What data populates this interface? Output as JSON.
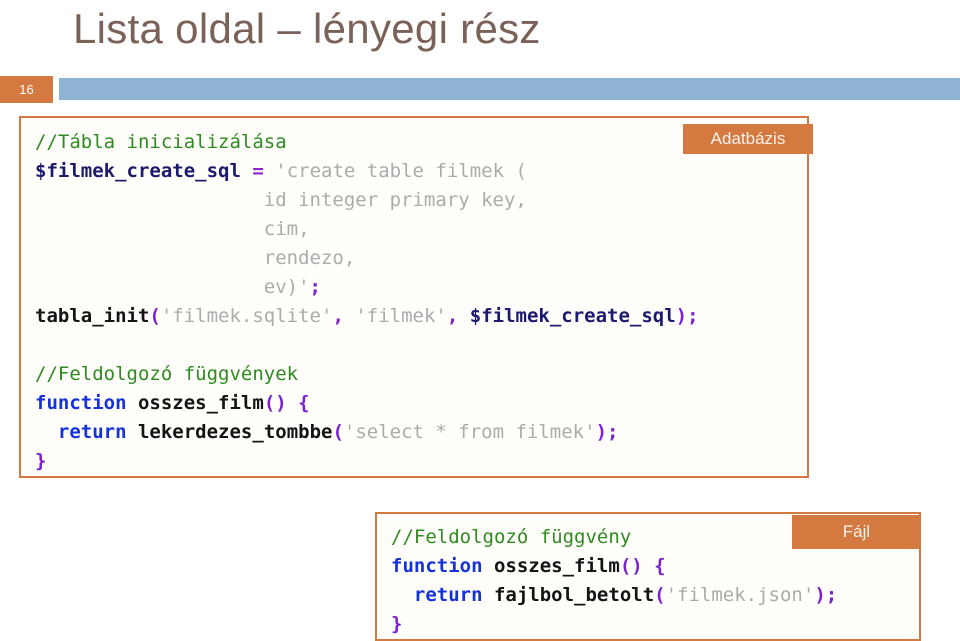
{
  "slide": {
    "title": "Lista oldal – lényegi rész",
    "number": "16",
    "title_color": "#7A6258",
    "accent_color": "#D4793F",
    "rule_color": "#8FB3D2"
  },
  "database_block": {
    "tag": "Adatbázis",
    "lines": [
      [
        {
          "text": "//Tábla inicializálása",
          "type": "comment"
        }
      ],
      [
        {
          "text": "$filmek_create_sql",
          "type": "var"
        },
        {
          "text": " ",
          "type": "plain"
        },
        {
          "text": "=",
          "type": "op"
        },
        {
          "text": " ",
          "type": "plain"
        },
        {
          "text": "'create table filmek (",
          "type": "string"
        }
      ],
      [
        {
          "text": "                    id integer primary key,",
          "type": "string"
        }
      ],
      [
        {
          "text": "                    cim,",
          "type": "string"
        }
      ],
      [
        {
          "text": "                    rendezo,",
          "type": "string"
        }
      ],
      [
        {
          "text": "                    ev)'",
          "type": "string"
        },
        {
          "text": ";",
          "type": "punct"
        }
      ],
      [
        {
          "text": "tabla_init",
          "type": "fn"
        },
        {
          "text": "(",
          "type": "punct"
        },
        {
          "text": "'filmek.sqlite'",
          "type": "string"
        },
        {
          "text": ",",
          "type": "punct"
        },
        {
          "text": " ",
          "type": "plain"
        },
        {
          "text": "'filmek'",
          "type": "string"
        },
        {
          "text": ",",
          "type": "punct"
        },
        {
          "text": " ",
          "type": "plain"
        },
        {
          "text": "$filmek_create_sql",
          "type": "var"
        },
        {
          "text": ");",
          "type": "punct"
        }
      ],
      [
        {
          "text": "",
          "type": "plain"
        }
      ],
      [
        {
          "text": "//Feldolgozó függvények",
          "type": "comment"
        }
      ],
      [
        {
          "text": "function",
          "type": "kw"
        },
        {
          "text": " ",
          "type": "plain"
        },
        {
          "text": "osszes_film",
          "type": "fn"
        },
        {
          "text": "() {",
          "type": "punct"
        }
      ],
      [
        {
          "text": "  ",
          "type": "plain"
        },
        {
          "text": "return",
          "type": "kw"
        },
        {
          "text": " ",
          "type": "plain"
        },
        {
          "text": "lekerdezes_tombbe",
          "type": "fn"
        },
        {
          "text": "(",
          "type": "punct"
        },
        {
          "text": "'select * from filmek'",
          "type": "string"
        },
        {
          "text": ");",
          "type": "punct"
        }
      ],
      [
        {
          "text": "}",
          "type": "punct"
        }
      ]
    ]
  },
  "file_block": {
    "tag": "Fájl",
    "lines": [
      [
        {
          "text": "//Feldolgozó függvény",
          "type": "comment"
        }
      ],
      [
        {
          "text": "function",
          "type": "kw"
        },
        {
          "text": " ",
          "type": "plain"
        },
        {
          "text": "osszes_film",
          "type": "fn"
        },
        {
          "text": "() {",
          "type": "punct"
        }
      ],
      [
        {
          "text": "  ",
          "type": "plain"
        },
        {
          "text": "return",
          "type": "kw"
        },
        {
          "text": " ",
          "type": "plain"
        },
        {
          "text": "fajlbol_betolt",
          "type": "fn"
        },
        {
          "text": "(",
          "type": "punct"
        },
        {
          "text": "'filmek.json'",
          "type": "string"
        },
        {
          "text": ");",
          "type": "punct"
        }
      ],
      [
        {
          "text": "}",
          "type": "punct"
        }
      ]
    ]
  }
}
